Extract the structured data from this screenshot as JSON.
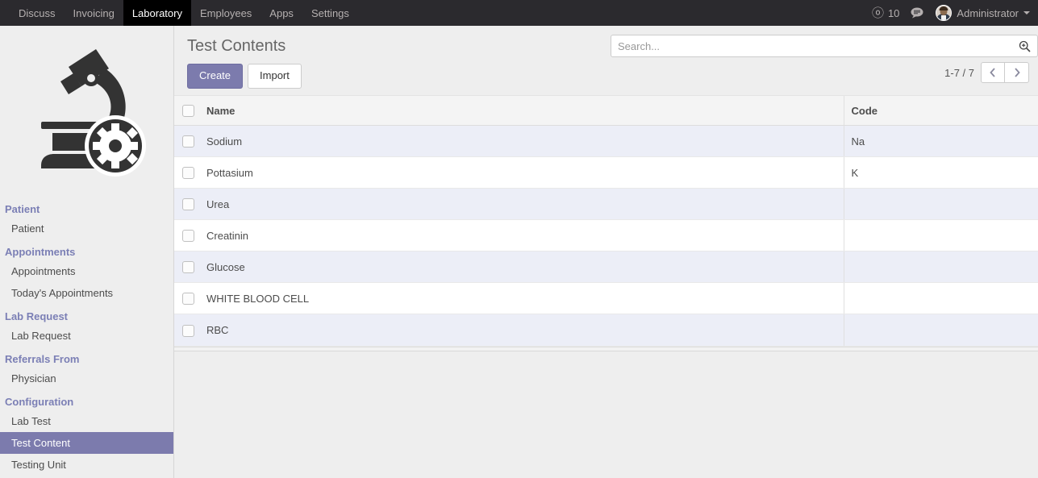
{
  "navbar": {
    "menu": [
      {
        "label": "Discuss",
        "active": false
      },
      {
        "label": "Invoicing",
        "active": false
      },
      {
        "label": "Laboratory",
        "active": true
      },
      {
        "label": "Employees",
        "active": false
      },
      {
        "label": "Apps",
        "active": false
      },
      {
        "label": "Settings",
        "active": false
      }
    ],
    "mention_icon": "at-icon",
    "mention_count": "10",
    "chat_icon": "chat-bubble-icon",
    "user_name": "Administrator",
    "user_caret_icon": "caret-down-icon",
    "background_color": "#2b2a2e",
    "active_tab_color": "#000000"
  },
  "sidebar": {
    "logo_icon": "microscope-gear-logo",
    "active_item": "Test Content",
    "active_color": "#7c7bad",
    "section_header_color": "#7b7fb5",
    "sections": [
      {
        "title": "Patient",
        "items": [
          {
            "label": "Patient",
            "active": false
          }
        ]
      },
      {
        "title": "Appointments",
        "items": [
          {
            "label": "Appointments",
            "active": false
          },
          {
            "label": "Today's Appointments",
            "active": false
          }
        ]
      },
      {
        "title": "Lab Request",
        "items": [
          {
            "label": "Lab Request",
            "active": false
          }
        ]
      },
      {
        "title": "Referrals From",
        "items": [
          {
            "label": "Physician",
            "active": false
          }
        ]
      },
      {
        "title": "Configuration",
        "items": [
          {
            "label": "Lab Test",
            "active": false
          },
          {
            "label": "Test Content",
            "active": true
          },
          {
            "label": "Testing Unit",
            "active": false
          }
        ]
      }
    ]
  },
  "main": {
    "page_title": "Test Contents",
    "buttons": {
      "create_label": "Create",
      "import_label": "Import",
      "create_color": "#7c7bad"
    },
    "search": {
      "value": "",
      "placeholder": "Search...",
      "icon": "magnifier-plus-icon"
    },
    "pagination": {
      "range_text": "1-7 / 7",
      "prev_icon": "chevron-left-icon",
      "next_icon": "chevron-right-icon"
    },
    "table": {
      "select_all_checkbox": "select-all-checkbox",
      "columns": [
        "Name",
        "Code"
      ],
      "rows": [
        {
          "name": "Sodium",
          "code": "Na"
        },
        {
          "name": "Pottasium",
          "code": "K"
        },
        {
          "name": "Urea",
          "code": ""
        },
        {
          "name": "Creatinin",
          "code": ""
        },
        {
          "name": "Glucose",
          "code": ""
        },
        {
          "name": "WHITE BLOOD CELL",
          "code": ""
        },
        {
          "name": "RBC",
          "code": ""
        }
      ]
    }
  }
}
